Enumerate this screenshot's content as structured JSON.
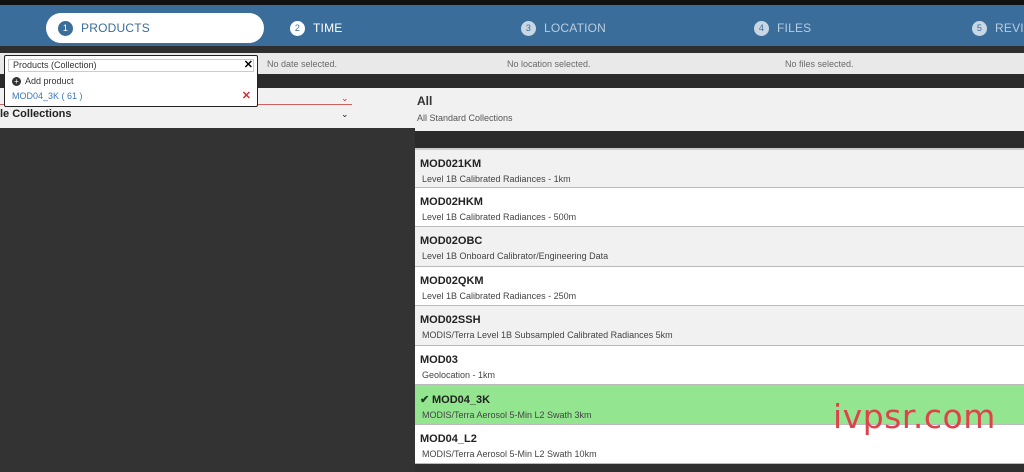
{
  "steps": [
    {
      "num": "1",
      "label": "PRODUCTS"
    },
    {
      "num": "2",
      "label": "TIME"
    },
    {
      "num": "3",
      "label": "LOCATION"
    },
    {
      "num": "4",
      "label": "FILES"
    },
    {
      "num": "5",
      "label": "REVIE"
    }
  ],
  "summary": {
    "date": "No date selected.",
    "location": "No location selected.",
    "files": "No files selected."
  },
  "popup": {
    "title": "Products (Collection)",
    "close": "✕",
    "add": "Add product",
    "selected": "MOD04_3K ( 61 )",
    "remove": "✕"
  },
  "left": {
    "collections_label": "le Collections",
    "chevron": "⌄"
  },
  "header": {
    "title": "All",
    "subtitle": "All Standard Collections"
  },
  "products": [
    {
      "name": "MOD021KM",
      "desc": "Level 1B Calibrated Radiances - 1km"
    },
    {
      "name": "MOD02HKM",
      "desc": "Level 1B Calibrated Radiances - 500m"
    },
    {
      "name": "MOD02OBC",
      "desc": "Level 1B Onboard Calibrator/Engineering Data"
    },
    {
      "name": "MOD02QKM",
      "desc": "Level 1B Calibrated Radiances - 250m"
    },
    {
      "name": "MOD02SSH",
      "desc": "MODIS/Terra Level 1B Subsampled Calibrated Radiances 5km"
    },
    {
      "name": "MOD03",
      "desc": "Geolocation - 1km"
    },
    {
      "name": "MOD04_3K",
      "desc": "MODIS/Terra Aerosol 5-Min L2 Swath 3km",
      "check": "✔"
    },
    {
      "name": "MOD04_L2",
      "desc": "MODIS/Terra Aerosol 5-Min L2 Swath 10km"
    }
  ],
  "colors": {
    "nav": "#3a6d9a",
    "selected_row": "#93e58f"
  },
  "watermark": "ivpsr.com"
}
